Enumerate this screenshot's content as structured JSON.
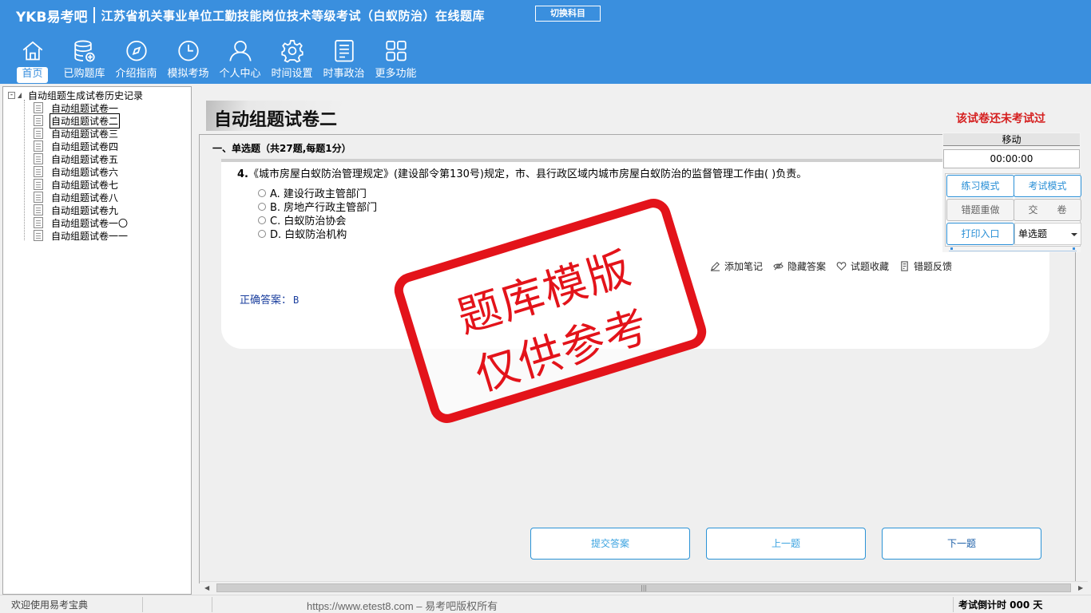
{
  "header": {
    "logo": "YKB易考吧",
    "title": "江苏省机关事业单位工勤技能岗位技术等级考试（白蚁防治）在线题库",
    "switch_label": "切换科目"
  },
  "nav": [
    {
      "label": "首页",
      "icon": "home-icon"
    },
    {
      "label": "已购题库",
      "icon": "database-icon"
    },
    {
      "label": "介绍指南",
      "icon": "compass-icon"
    },
    {
      "label": "模拟考场",
      "icon": "clock-icon"
    },
    {
      "label": "个人中心",
      "icon": "user-icon"
    },
    {
      "label": "时间设置",
      "icon": "gear-icon"
    },
    {
      "label": "时事政治",
      "icon": "news-icon"
    },
    {
      "label": "更多功能",
      "icon": "grid-icon"
    }
  ],
  "tree": {
    "root": "自动组题生成试卷历史记录",
    "expander": "-",
    "items": [
      "自动组题试卷一",
      "自动组题试卷二",
      "自动组题试卷三",
      "自动组题试卷四",
      "自动组题试卷五",
      "自动组题试卷六",
      "自动组题试卷七",
      "自动组题试卷八",
      "自动组题试卷九",
      "自动组题试卷一〇",
      "自动组题试卷一一"
    ],
    "selected_index": 1
  },
  "paper": {
    "title": "自动组题试卷二",
    "status": "该试卷还未考试过",
    "section": "一、单选题（共27题,每题1分）",
    "question_number": "4.",
    "question_text": "《城市房屋白蚁防治管理规定》(建设部令第130号)规定，市、县行政区域内城市房屋白蚁防治的监督管理工作由( )负责。",
    "options": [
      "A. 建设行政主管部门",
      "B. 房地产行政主管部门",
      "C. 白蚁防治协会",
      "D. 白蚁防治机构"
    ],
    "answer_label": "正确答案：",
    "answer_value": "B"
  },
  "tools": [
    {
      "label": "添加笔记",
      "icon": "pencil-icon"
    },
    {
      "label": "隐藏答案",
      "icon": "eye-hide-icon"
    },
    {
      "label": "试题收藏",
      "icon": "heart-icon"
    },
    {
      "label": "错题反馈",
      "icon": "feedback-icon"
    }
  ],
  "actions": {
    "submit": "提交答案",
    "prev": "上一题",
    "next": "下一题"
  },
  "control": {
    "move": "移动",
    "timer": "00:00:00",
    "practice_mode": "练习模式",
    "exam_mode": "考试模式",
    "redo_wrong": "错题重做",
    "hand_in": "交　　卷",
    "print": "打印入口",
    "type_select": "单选题"
  },
  "watermark": {
    "line1": "题库模版",
    "line2": "仅供参考"
  },
  "status": {
    "welcome": "欢迎使用易考宝典",
    "url": "https://www.etest8.com – 易考吧版权所有",
    "countdown": "考试倒计时 000 天"
  },
  "colors": {
    "header_bg": "#3a8fde",
    "stamp_red": "#e3131a",
    "status_red": "#d51f1f",
    "answer_blue": "#1b3f9e",
    "button_border": "#2b93d6"
  }
}
